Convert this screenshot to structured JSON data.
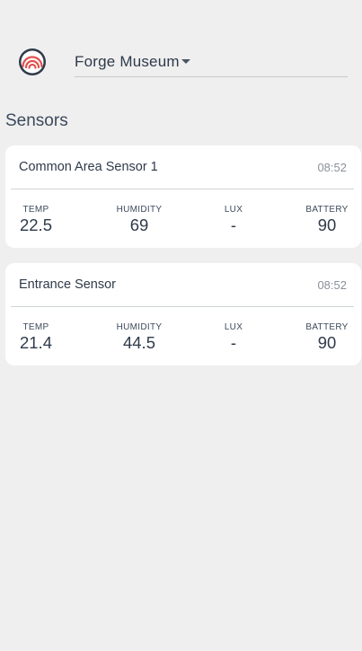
{
  "header": {
    "logo_icon": "ripple-logo-icon",
    "site_name": "Forge Museum",
    "dropdown_icon": "caret-down-icon"
  },
  "section": {
    "title": "Sensors"
  },
  "sensors": [
    {
      "name": "Common Area Sensor 1",
      "time": "08:52",
      "metrics": {
        "temp": {
          "label": "TEMP",
          "value": "22.5"
        },
        "humidity": {
          "label": "HUMIDITY",
          "value": "69"
        },
        "lux": {
          "label": "LUX",
          "value": "-"
        },
        "battery": {
          "label": "BATTERY",
          "value": "90"
        }
      }
    },
    {
      "name": "Entrance Sensor",
      "time": "08:52",
      "metrics": {
        "temp": {
          "label": "TEMP",
          "value": "21.4"
        },
        "humidity": {
          "label": "HUMIDITY",
          "value": "44.5"
        },
        "lux": {
          "label": "LUX",
          "value": "-"
        },
        "battery": {
          "label": "BATTERY",
          "value": "90"
        }
      }
    }
  ],
  "colors": {
    "background": "#efefef",
    "card": "#ffffff",
    "logo_accent": "#e0524f",
    "text": "#2f3a4a"
  }
}
